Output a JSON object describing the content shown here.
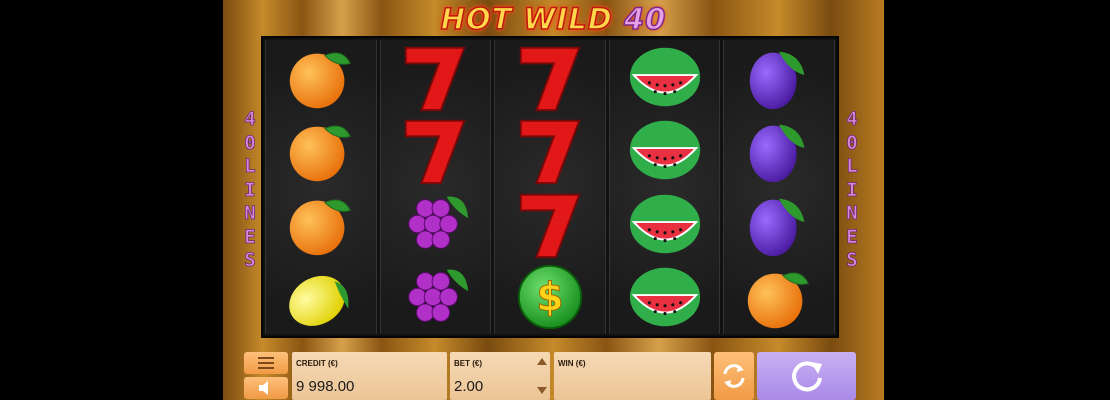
{
  "game": {
    "title_main": "HOT WILD",
    "title_number": "40",
    "lines_text": "40LINES"
  },
  "reels": [
    [
      "orange",
      "orange",
      "orange",
      "lemon"
    ],
    [
      "seven",
      "seven",
      "grapes",
      "grapes"
    ],
    [
      "seven",
      "seven",
      "seven",
      "dollar"
    ],
    [
      "watermelon",
      "watermelon",
      "watermelon",
      "watermelon"
    ],
    [
      "plum",
      "plum",
      "plum",
      "orange"
    ]
  ],
  "controls": {
    "menu_icon": "menu-icon",
    "sound_icon": "speaker-icon",
    "credit_label": "CREDIT (€)",
    "credit_value": "9 998.00",
    "bet_label": "BET (€)",
    "bet_value": "2.00",
    "win_label": "WIN (€)",
    "win_value": "",
    "autoplay_icon": "autoplay-icon",
    "spin_icon": "spin-icon"
  },
  "colors": {
    "accent_orange": "#f09a45",
    "spin_purple": "#a98ae8",
    "title_yellow": "#ffd74a",
    "lines_pink": "#d887d9"
  }
}
